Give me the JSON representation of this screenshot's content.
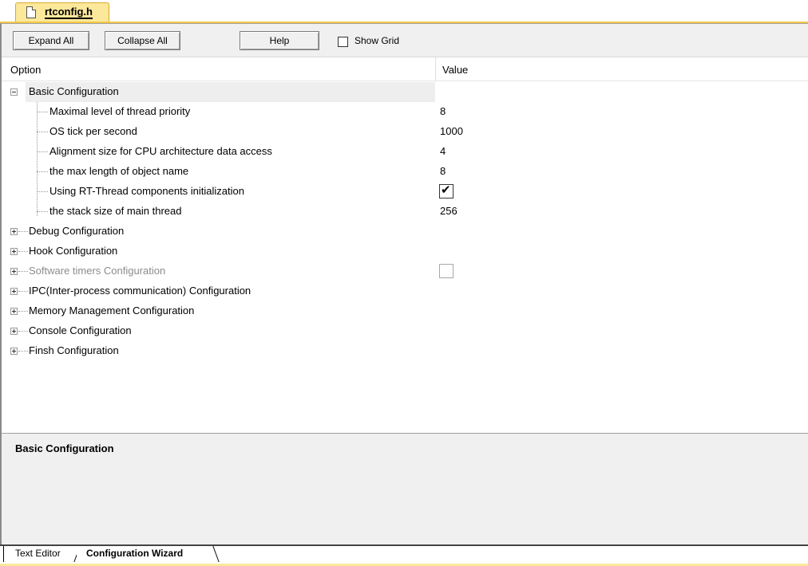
{
  "file_tab": {
    "name": "rtconfig.h",
    "icon": "document-icon"
  },
  "toolbar": {
    "expand_all": "Expand All",
    "collapse_all": "Collapse All",
    "help": "Help",
    "show_grid_label": "Show Grid",
    "show_grid_checked": false
  },
  "columns": {
    "option": "Option",
    "value": "Value"
  },
  "tree": {
    "basic": {
      "label": "Basic Configuration",
      "expanded": true
    },
    "children": [
      {
        "label": "Maximal level of thread priority",
        "value": "8"
      },
      {
        "label": "OS tick per second",
        "value": "1000"
      },
      {
        "label": "Alignment size for CPU architecture data access",
        "value": "4"
      },
      {
        "label": "the max length of object name",
        "value": "8"
      },
      {
        "label": "Using RT-Thread components initialization",
        "checked": true
      },
      {
        "label": "the stack size of main thread",
        "value": "256"
      }
    ],
    "groups": [
      {
        "label": "Debug Configuration"
      },
      {
        "label": "Hook Configuration"
      },
      {
        "label": "Software timers Configuration",
        "disabled": true,
        "checked": false
      },
      {
        "label": "IPC(Inter-process communication) Configuration"
      },
      {
        "label": "Memory Management Configuration"
      },
      {
        "label": "Console Configuration"
      },
      {
        "label": "Finsh Configuration"
      }
    ]
  },
  "description": {
    "title": "Basic Configuration"
  },
  "bottom_tabs": {
    "text_editor": "Text Editor",
    "config_wizard": "Configuration Wizard"
  },
  "colors": {
    "tab_yellow": "#fbe89a",
    "accent_line": "#f5c846",
    "selected_row": "#eeeeee",
    "panel_gray": "#f0f0f0"
  }
}
